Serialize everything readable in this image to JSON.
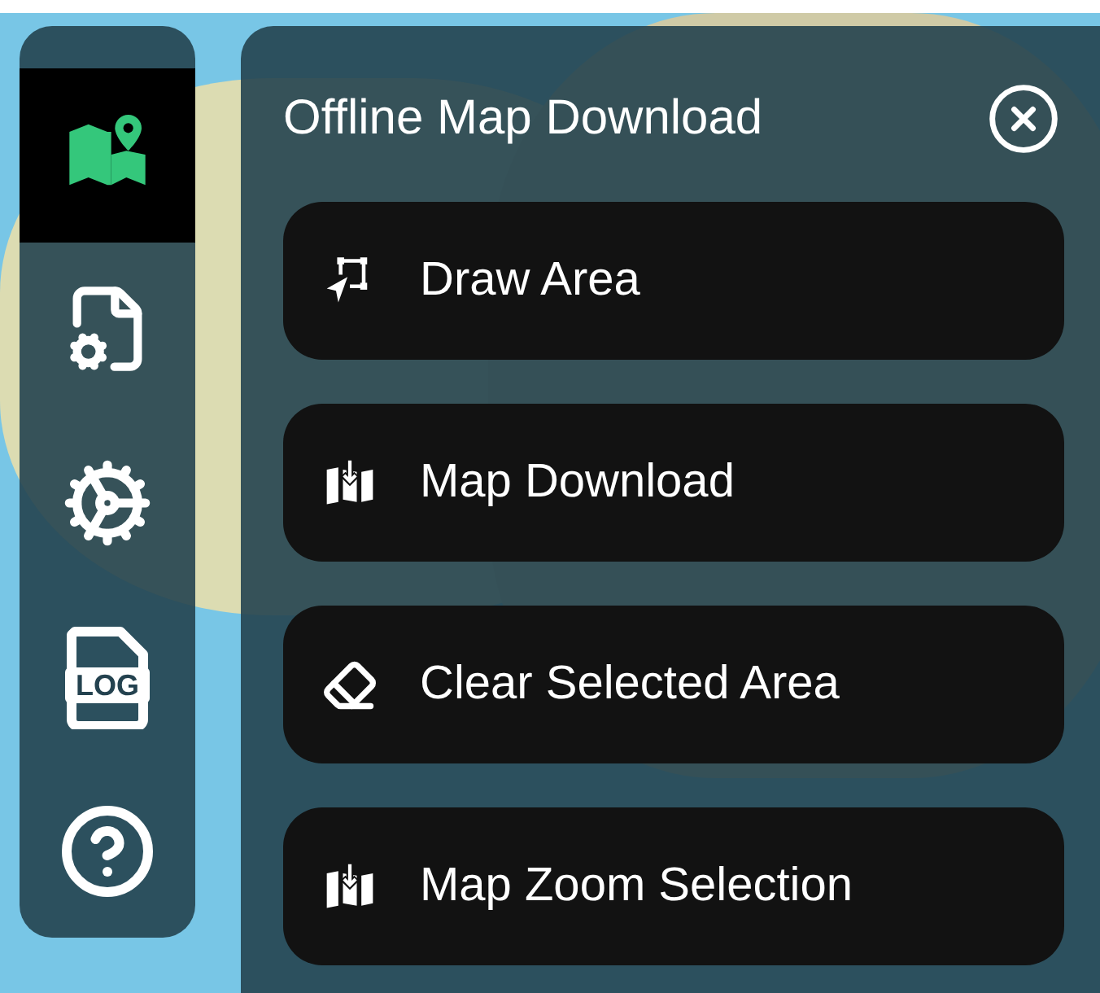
{
  "sidebar": {
    "items": [
      {
        "kind": "map",
        "selected": true
      },
      {
        "kind": "file-settings",
        "selected": false
      },
      {
        "kind": "settings",
        "selected": false
      },
      {
        "kind": "log",
        "label": "LOG",
        "selected": false
      },
      {
        "kind": "help",
        "selected": false
      }
    ]
  },
  "panel": {
    "title": "Offline Map Download",
    "actions": [
      {
        "label": "Draw Area",
        "kind": "draw"
      },
      {
        "label": "Map Download",
        "kind": "download"
      },
      {
        "label": "Clear Selected Area",
        "kind": "clear"
      },
      {
        "label": "Map Zoom Selection",
        "kind": "download"
      }
    ]
  }
}
